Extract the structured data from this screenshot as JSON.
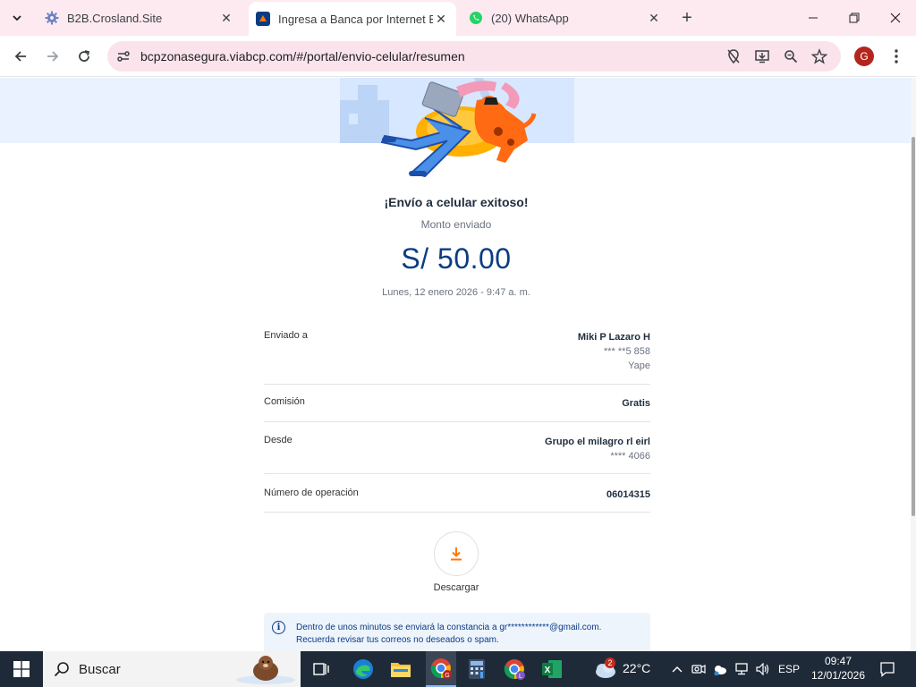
{
  "browser": {
    "tabs": [
      {
        "title": "B2B.Crosland.Site",
        "favicon": "gear-favicon",
        "active": false
      },
      {
        "title": "Ingresa a Banca por Internet BC",
        "favicon": "bcp-favicon",
        "active": true
      },
      {
        "title": "(20) WhatsApp",
        "favicon": "whatsapp-favicon",
        "active": false
      }
    ],
    "url": "bcpzonasegura.viabcp.com/#/portal/envio-celular/resumen",
    "profile_initial": "G"
  },
  "page": {
    "success_title": "¡Envío a celular exitoso!",
    "amount_label": "Monto enviado",
    "amount": "S/ 50.00",
    "datetime": "Lunes, 12 enero 2026 - 9:47 a. m.",
    "details": {
      "recipient": {
        "label": "Enviado a",
        "name": "Miki P Lazaro H",
        "phone": "*** **5 858",
        "app": "Yape"
      },
      "commission": {
        "label": "Comisión",
        "value": "Gratis"
      },
      "from": {
        "label": "Desde",
        "account": "Grupo el milagro rl eirl",
        "number": "**** 4066"
      },
      "operation": {
        "label": "Número de operación",
        "value": "06014315"
      }
    },
    "download_label": "Descargar",
    "info_line1": "Dentro de unos minutos se enviará la constancia a gr************@gmail.com.",
    "info_line2": "Recuerda revisar tus correos no deseados o spam."
  },
  "taskbar": {
    "search_placeholder": "Buscar",
    "weather_temp": "22°C",
    "weather_badge": "2",
    "language": "ESP",
    "time": "09:47",
    "date": "12/01/2026"
  },
  "colors": {
    "brand_blue": "#0a3c84",
    "brand_orange": "#ff7800",
    "tab_strip": "#fdeaf1"
  }
}
